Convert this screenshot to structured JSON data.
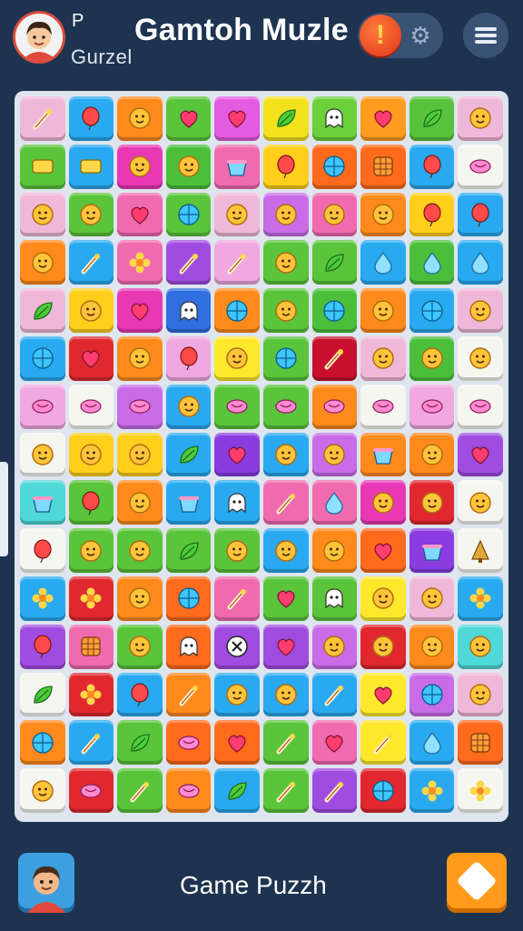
{
  "header": {
    "player_initial": "P",
    "player_name": "Gurzel",
    "title": "Gamtoh Muzle",
    "alert_symbol": "!",
    "gear_symbol": "⚙"
  },
  "footer": {
    "label": "Game Puzzh"
  },
  "board": {
    "columns": 10,
    "rows": [
      [
        [
          "#f0b8d8",
          "wand"
        ],
        [
          "#29a9f0",
          "balloon"
        ],
        [
          "#ff8a1c",
          "face"
        ],
        [
          "#5ac43a",
          "heart"
        ],
        [
          "#e45be0",
          "heart"
        ],
        [
          "#f2e21c",
          "leaf"
        ],
        [
          "#6bd03a",
          "ghost"
        ],
        [
          "#ff9b1f",
          "heart"
        ],
        [
          "#59c23c",
          "leaf"
        ],
        [
          "#f0b8d8",
          "face"
        ]
      ],
      [
        [
          "#5ac43a",
          "block"
        ],
        [
          "#29a9f0",
          "block"
        ],
        [
          "#e838b4",
          "face"
        ],
        [
          "#4bbf3a",
          "face"
        ],
        [
          "#f06ab0",
          "basket"
        ],
        [
          "#ffcf1c",
          "balloon"
        ],
        [
          "#ff6a1c",
          "ball"
        ],
        [
          "#ff6a1c",
          "waffle"
        ],
        [
          "#29a9f0",
          "balloon"
        ],
        [
          "#f6f6f0",
          "candy"
        ]
      ],
      [
        [
          "#f0b8d8",
          "face"
        ],
        [
          "#5ac43a",
          "face"
        ],
        [
          "#f06ab0",
          "heart"
        ],
        [
          "#5ac43a",
          "ball"
        ],
        [
          "#f0b8d8",
          "face"
        ],
        [
          "#c86ce8",
          "face"
        ],
        [
          "#f06ab0",
          "face"
        ],
        [
          "#ff8a1c",
          "face"
        ],
        [
          "#ffcf1c",
          "balloon"
        ],
        [
          "#29a9f0",
          "balloon"
        ]
      ],
      [
        [
          "#ff8a1c",
          "face"
        ],
        [
          "#29a9f0",
          "wand"
        ],
        [
          "#f06ab0",
          "flower"
        ],
        [
          "#a04ce0",
          "wand"
        ],
        [
          "#f0a8e0",
          "wand"
        ],
        [
          "#5ac43a",
          "face"
        ],
        [
          "#5ac43a",
          "leaf"
        ],
        [
          "#29a9f0",
          "drop"
        ],
        [
          "#4bbf3a",
          "drop"
        ],
        [
          "#29a9f0",
          "drop"
        ]
      ],
      [
        [
          "#f0b8d8",
          "leaf"
        ],
        [
          "#ffcf1c",
          "face"
        ],
        [
          "#e838b4",
          "heart"
        ],
        [
          "#2f6fe0",
          "ghost"
        ],
        [
          "#ff8a1c",
          "ball"
        ],
        [
          "#5ac43a",
          "face"
        ],
        [
          "#4bbf3a",
          "ball"
        ],
        [
          "#ff8a1c",
          "face"
        ],
        [
          "#29a9f0",
          "ball"
        ],
        [
          "#f0b8d8",
          "face"
        ]
      ],
      [
        [
          "#29a9f0",
          "ball"
        ],
        [
          "#e0282e",
          "heart"
        ],
        [
          "#ff8a1c",
          "face"
        ],
        [
          "#f0a8e0",
          "balloon"
        ],
        [
          "#ffe82c",
          "face"
        ],
        [
          "#5ac43a",
          "ball"
        ],
        [
          "#c8102e",
          "wand"
        ],
        [
          "#f0b8d8",
          "face"
        ],
        [
          "#4bbf3a",
          "face"
        ],
        [
          "#f6f6f0",
          "face"
        ]
      ],
      [
        [
          "#f0a8e0",
          "candy"
        ],
        [
          "#f6f6f0",
          "candy"
        ],
        [
          "#c86ce8",
          "candy"
        ],
        [
          "#29a9f0",
          "face"
        ],
        [
          "#5ac43a",
          "candy"
        ],
        [
          "#5ac43a",
          "candy"
        ],
        [
          "#ff8a1c",
          "candy"
        ],
        [
          "#f6f6f0",
          "candy"
        ],
        [
          "#f0a8e0",
          "candy"
        ],
        [
          "#f6f6f0",
          "candy"
        ]
      ],
      [
        [
          "#f6f6f0",
          "face"
        ],
        [
          "#ffcf1c",
          "face"
        ],
        [
          "#ffcf1c",
          "face"
        ],
        [
          "#29a9f0",
          "leaf"
        ],
        [
          "#8a3ce0",
          "heart"
        ],
        [
          "#29a9f0",
          "face"
        ],
        [
          "#c86ce8",
          "face"
        ],
        [
          "#ff8a1c",
          "basket"
        ],
        [
          "#ff8a1c",
          "face"
        ],
        [
          "#a04ce0",
          "heart"
        ]
      ],
      [
        [
          "#4fd8d8",
          "basket"
        ],
        [
          "#5ac43a",
          "balloon"
        ],
        [
          "#ff8a1c",
          "face"
        ],
        [
          "#29a9f0",
          "basket"
        ],
        [
          "#29a9f0",
          "ghost"
        ],
        [
          "#f06ab0",
          "wand"
        ],
        [
          "#f06ab0",
          "drop"
        ],
        [
          "#e838b4",
          "face"
        ],
        [
          "#e0282e",
          "face"
        ],
        [
          "#f6f6f0",
          "face"
        ]
      ],
      [
        [
          "#f6f6f0",
          "balloon"
        ],
        [
          "#5ac43a",
          "face"
        ],
        [
          "#5ac43a",
          "face"
        ],
        [
          "#5ac43a",
          "leaf"
        ],
        [
          "#5ac43a",
          "face"
        ],
        [
          "#29a9f0",
          "face"
        ],
        [
          "#ff8a1c",
          "face"
        ],
        [
          "#ff6a1c",
          "heart"
        ],
        [
          "#8a3ce0",
          "basket"
        ],
        [
          "#f6f6f0",
          "tree"
        ]
      ],
      [
        [
          "#29a9f0",
          "flower"
        ],
        [
          "#e0282e",
          "flower"
        ],
        [
          "#ff8a1c",
          "face"
        ],
        [
          "#ff6a1c",
          "ball"
        ],
        [
          "#f06ab0",
          "wand"
        ],
        [
          "#5ac43a",
          "heart"
        ],
        [
          "#5ac43a",
          "ghost"
        ],
        [
          "#ffe82c",
          "face"
        ],
        [
          "#f0b8d8",
          "face"
        ],
        [
          "#29a9f0",
          "flower"
        ]
      ],
      [
        [
          "#a04ce0",
          "balloon"
        ],
        [
          "#f06ab0",
          "waffle"
        ],
        [
          "#5ac43a",
          "face"
        ],
        [
          "#ff6a1c",
          "ghost"
        ],
        [
          "#a04ce0",
          "cross"
        ],
        [
          "#a04ce0",
          "heart"
        ],
        [
          "#c86ce8",
          "face"
        ],
        [
          "#e0282e",
          "face"
        ],
        [
          "#ff8a1c",
          "face"
        ],
        [
          "#4fd8d8",
          "face"
        ]
      ],
      [
        [
          "#f6f6f0",
          "leaf"
        ],
        [
          "#e0282e",
          "flower"
        ],
        [
          "#29a9f0",
          "balloon"
        ],
        [
          "#ff8a1c",
          "wand"
        ],
        [
          "#29a9f0",
          "face"
        ],
        [
          "#29a9f0",
          "face"
        ],
        [
          "#29a9f0",
          "wand"
        ],
        [
          "#ffe82c",
          "heart"
        ],
        [
          "#c86ce8",
          "ball"
        ],
        [
          "#f0b8d8",
          "face"
        ]
      ],
      [
        [
          "#ff8a1c",
          "ball"
        ],
        [
          "#29a9f0",
          "wand"
        ],
        [
          "#5ac43a",
          "leaf"
        ],
        [
          "#ff6a1c",
          "candy"
        ],
        [
          "#ff6a1c",
          "heart"
        ],
        [
          "#5ac43a",
          "wand"
        ],
        [
          "#f06ab0",
          "heart"
        ],
        [
          "#ffe82c",
          "wand"
        ],
        [
          "#29a9f0",
          "drop"
        ],
        [
          "#ff6a1c",
          "waffle"
        ]
      ],
      [
        [
          "#f6f6f0",
          "face"
        ],
        [
          "#e0282e",
          "candy"
        ],
        [
          "#5ac43a",
          "wand"
        ],
        [
          "#ff8a1c",
          "candy"
        ],
        [
          "#29a9f0",
          "leaf"
        ],
        [
          "#5ac43a",
          "wand"
        ],
        [
          "#a04ce0",
          "wand"
        ],
        [
          "#e0282e",
          "ball"
        ],
        [
          "#29a9f0",
          "flower"
        ],
        [
          "#f6f6f0",
          "flower"
        ]
      ]
    ]
  }
}
